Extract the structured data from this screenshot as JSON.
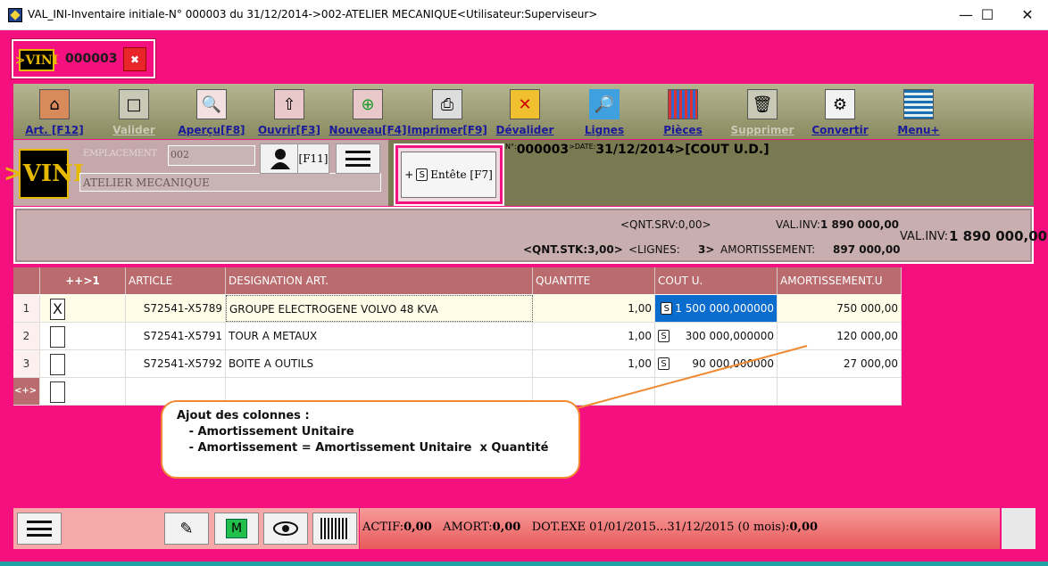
{
  "window": {
    "title": "VAL_INI-Inventaire initiale-N° 000003 du 31/12/2014->002-ATELIER MECANIQUE<Utilisateur:Superviseur>",
    "minimize": "—",
    "maximize": "☐",
    "close": "✕"
  },
  "badge": {
    "logo": ">VINI",
    "number": "000003"
  },
  "toolbar": {
    "items": [
      {
        "label": "Art. [F12]",
        "icon": "home-tools-icon",
        "enabled": true
      },
      {
        "label": "Valider",
        "icon": "validate-icon",
        "enabled": false
      },
      {
        "label": "Aperçu[F8]",
        "icon": "preview-icon",
        "enabled": true
      },
      {
        "label": "Ouvrir[F3]",
        "icon": "open-icon",
        "enabled": true
      },
      {
        "label": "Nouveau[F4]",
        "icon": "new-icon",
        "enabled": true
      },
      {
        "label": "Imprimer[F9]",
        "icon": "print-icon",
        "enabled": true
      },
      {
        "label": "Dévalider",
        "icon": "unvalidate-icon",
        "enabled": true
      },
      {
        "label": "Lignes",
        "icon": "search-lines-icon",
        "enabled": true
      },
      {
        "label": "Pièces",
        "icon": "pieces-icon",
        "enabled": true
      },
      {
        "label": "Supprimer",
        "icon": "delete-icon",
        "enabled": false
      },
      {
        "label": "Convertir",
        "icon": "convert-icon",
        "enabled": true
      },
      {
        "label": "Menu+",
        "icon": "menu-plus-icon",
        "enabled": true
      }
    ]
  },
  "header": {
    "logo": ">VINI",
    "emplacement_label": "EMPLACEMENT",
    "emplacement_value": "002",
    "atelier": "ATELIER MECANIQUE",
    "f11": "[F11]",
    "entete_label": "Entête [F7]",
    "entete_plus": "+",
    "entete_s": "S",
    "info_no_label": "N°:",
    "info_no": "000003",
    "info_date_label": ">DATE:",
    "info_date": "31/12/2014",
    "info_cout": ">[COUT U.D.]"
  },
  "summary": {
    "qnt_srv": "<QNT.SRV:0,00>",
    "val_inv_small_label": "VAL.INV:",
    "val_inv_small": "1 890 000,00",
    "qnt_stk": "<QNT.STK:3,00>",
    "lignes": "<LIGNES:",
    "lignes_count": "3>",
    "amort_label": "AMORTISSEMENT:",
    "amort_value": "897 000,00",
    "val_inv_label": "VAL.INV:",
    "val_inv": "1 890 000,00"
  },
  "grid": {
    "columns": [
      "++>1",
      "ARTICLE",
      "DESIGNATION ART.",
      "QUANTITE",
      "COUT U.",
      "AMORTISSEMENT.U"
    ],
    "rows": [
      {
        "num": "1",
        "check": "X",
        "article": "S72541-X5789",
        "designation": "GROUPE ELECTROGENE VOLVO 48 KVA",
        "quantite": "1,00",
        "s": "S",
        "cout": "1 500 000,000000",
        "amort": "750 000,00"
      },
      {
        "num": "2",
        "check": "",
        "article": "S72541-X5791",
        "designation": "TOUR A METAUX",
        "quantite": "1,00",
        "s": "S",
        "cout": "300 000,000000",
        "amort": "120 000,00"
      },
      {
        "num": "3",
        "check": "",
        "article": "S72541-X5792",
        "designation": "BOITE A OUTILS",
        "quantite": "1,00",
        "s": "S",
        "cout": "90 000,000000",
        "amort": "27 000,00"
      }
    ],
    "new_row_marker": "<+>"
  },
  "callout": {
    "text": "Ajout des colonnes :\n   - Amortissement Unitaire\n   - Amortissement = Amortissement Unitaire  x Quantité"
  },
  "status": {
    "actif_label": "ACTIF:",
    "actif": "0,00",
    "amort_label": "AMORT:",
    "amort": "0,00",
    "dot_label": "DOT.EXE 01/01/2015...31/12/2015  (0 mois):",
    "dot": "0,00",
    "m_label": "M"
  },
  "colors": {
    "frame": "#f4117f",
    "toolbar": "#a3a37a",
    "grid_header": "#b96b6d",
    "highlight": "#0a6ccc",
    "callout": "#f08a32"
  }
}
